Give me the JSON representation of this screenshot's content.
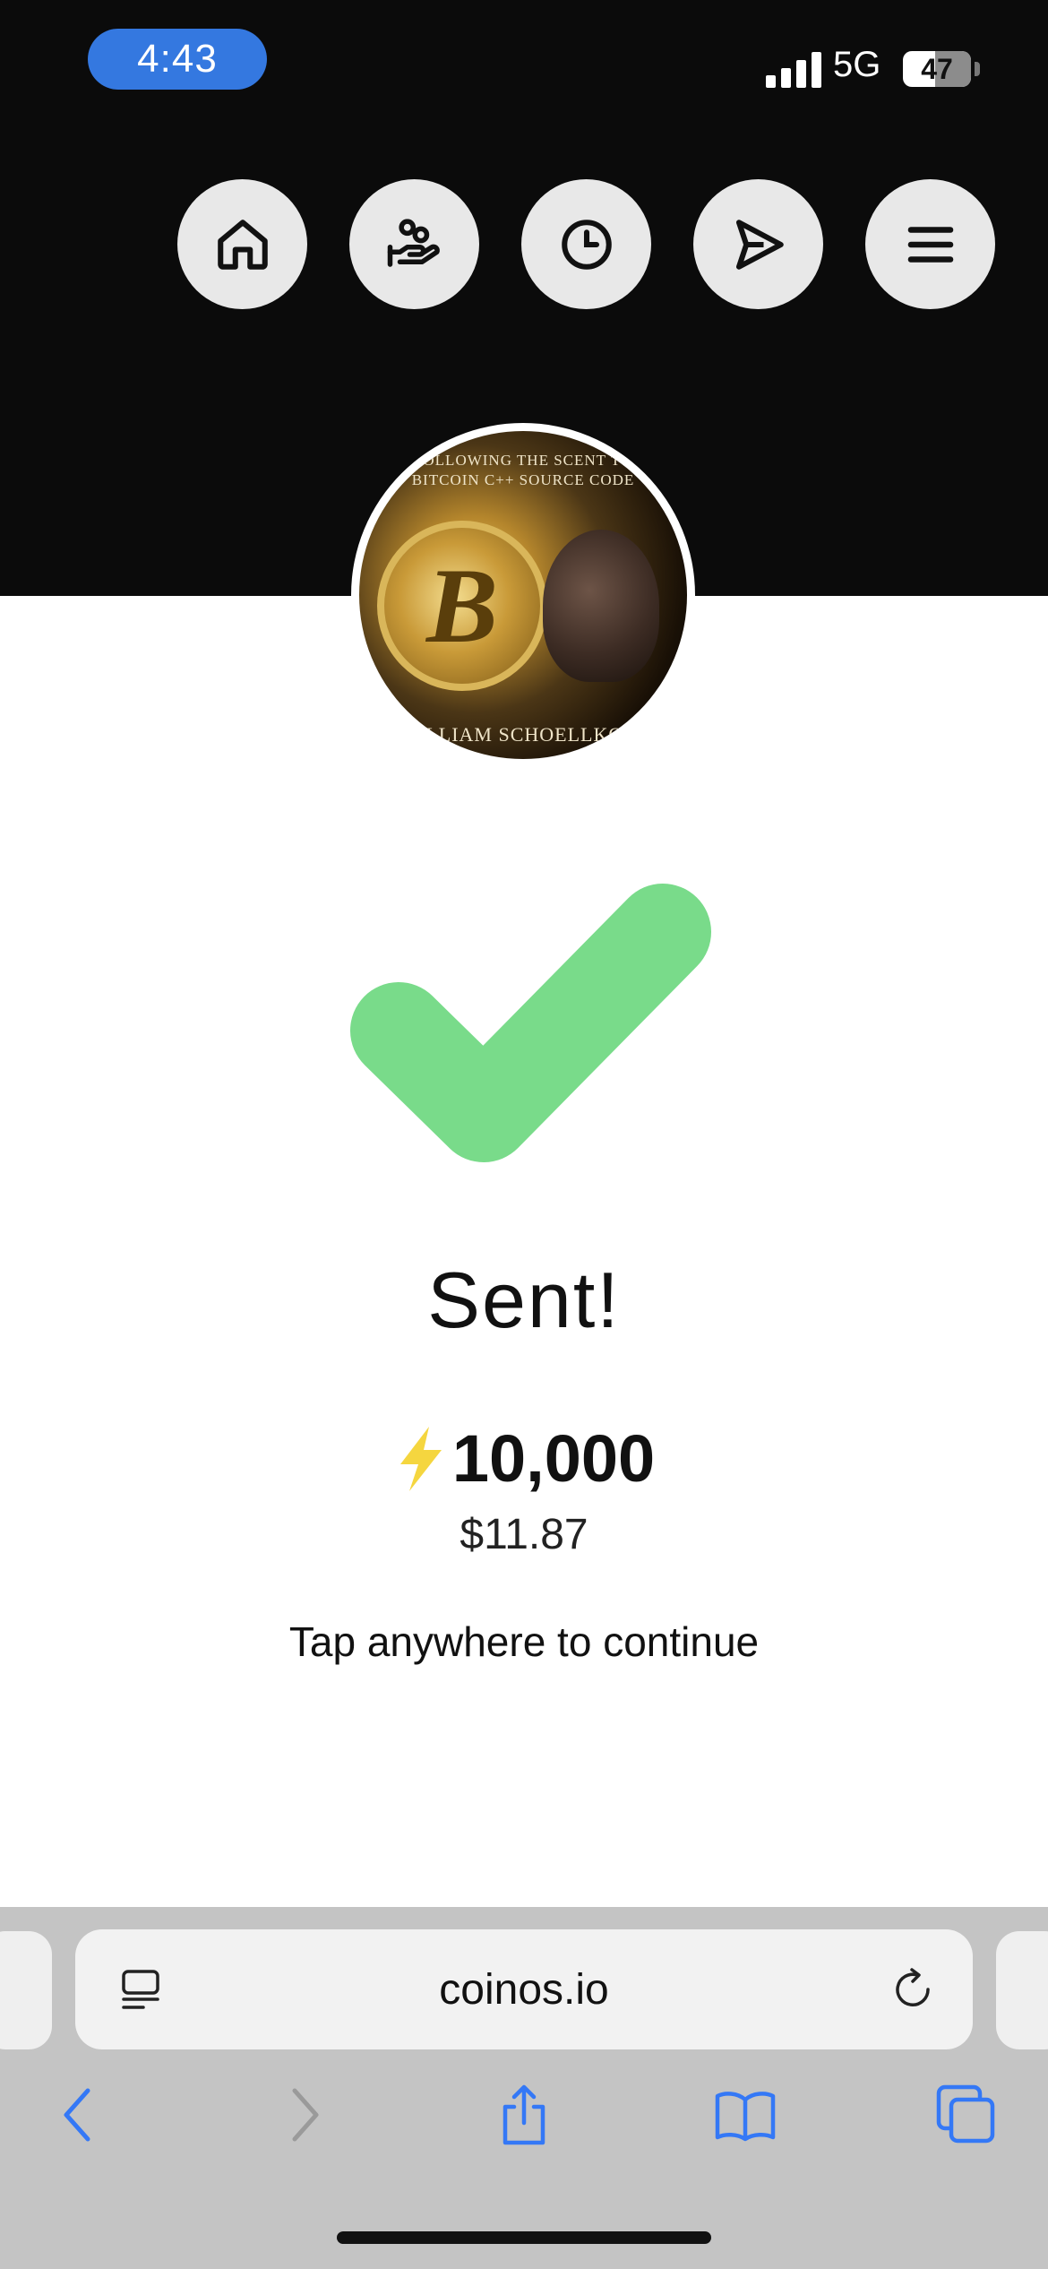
{
  "status_bar": {
    "time": "4:43",
    "network": "5G",
    "battery": "47"
  },
  "nav": {
    "items": [
      {
        "name": "home",
        "icon": "home-icon"
      },
      {
        "name": "receive",
        "icon": "hand-coins-icon"
      },
      {
        "name": "history",
        "icon": "clock-icon"
      },
      {
        "name": "send",
        "icon": "send-icon"
      },
      {
        "name": "menu",
        "icon": "hamburger-menu-icon"
      }
    ]
  },
  "avatar": {
    "cover_top_line1": "FOLLOWING THE SCENT TO",
    "cover_top_line2": "BITCOIN C++ SOURCE CODE",
    "cover_bottom": "WILLIAM SCHOELLKOPF"
  },
  "result": {
    "title": "Sent!",
    "amount": "10,000",
    "fiat": "$11.87",
    "hint": "Tap anywhere to continue"
  },
  "browser": {
    "url": "coinos.io"
  },
  "colors": {
    "header_bg": "#0b0b0b",
    "check_green": "#79db8a",
    "bolt_yellow": "#f5d63f",
    "safari_blue": "#3478f6"
  }
}
